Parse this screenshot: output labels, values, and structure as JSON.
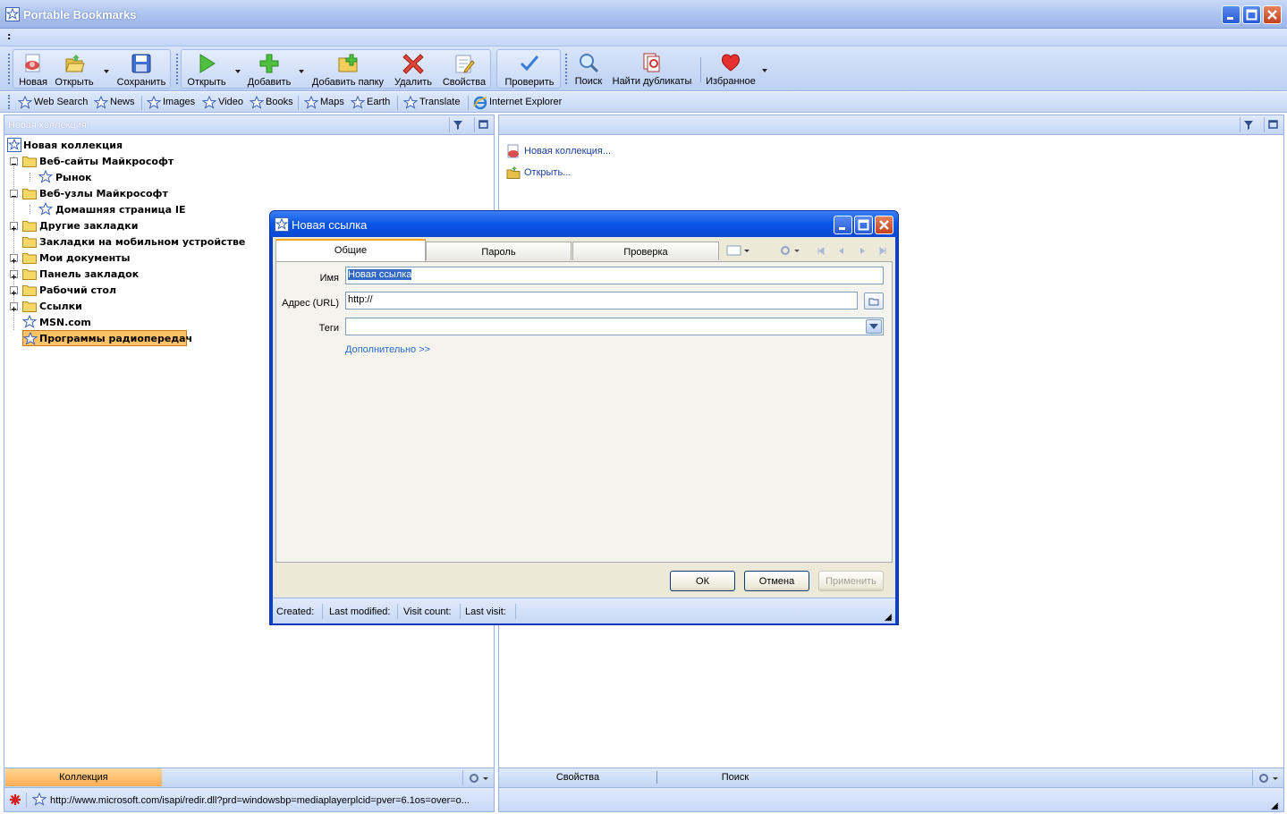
{
  "window": {
    "title": "Portable Bookmarks"
  },
  "menubar": {
    "overflow": ":"
  },
  "toolbar": {
    "new": "Новая",
    "open": "Открыть",
    "save": "Сохранить",
    "open2": "Открыть",
    "add": "Добавить",
    "add_folder": "Добавить папку",
    "delete": "Удалить",
    "properties": "Свойства",
    "check": "Проверить",
    "search": "Поиск",
    "find_duplicates": "Найти дубликаты",
    "favorites": "Избранное"
  },
  "links": [
    {
      "label": "Web Search"
    },
    {
      "label": "News"
    },
    {
      "label": "Images"
    },
    {
      "label": "Video"
    },
    {
      "label": "Books"
    },
    {
      "label": "Maps"
    },
    {
      "label": "Earth"
    },
    {
      "label": "Translate"
    },
    {
      "label": "Internet Explorer"
    }
  ],
  "left_panel": {
    "header": "Новая коллекция",
    "tree": [
      {
        "label": "Новая коллекция"
      },
      {
        "label": "Веб-сайты Майкрософт"
      },
      {
        "label": "Рынок"
      },
      {
        "label": "Веб-узлы Майкрософт"
      },
      {
        "label": "Домашняя страница IE"
      },
      {
        "label": "Другие закладки"
      },
      {
        "label": "Закладки на мобильном устройстве"
      },
      {
        "label": "Мои документы"
      },
      {
        "label": "Панель закладок"
      },
      {
        "label": "Рабочий стол"
      },
      {
        "label": "Ссылки"
      },
      {
        "label": "MSN.com"
      },
      {
        "label": "Программы радиопередач"
      }
    ],
    "tab_collection": "Коллекция",
    "status_url": "http://www.microsoft.com/isapi/redir.dll?prd=windowsbp=mediaplayerplcid=pver=6.1os=over=o..."
  },
  "right_panel": {
    "actions": [
      {
        "label": "Новая коллекция..."
      },
      {
        "label": "Открыть..."
      }
    ],
    "tab_properties": "Свойства",
    "tab_search": "Поиск"
  },
  "dialog": {
    "title": "Новая ссылка",
    "tabs": {
      "general": "Общие",
      "password": "Пароль",
      "check": "Проверка"
    },
    "name_label": "Имя",
    "name_value": "Новая ссылка",
    "url_label": "Адрес (URL)",
    "url_value": "http://",
    "tags_label": "Теги",
    "tags_value": "",
    "more_link": "Дополнительно >>",
    "ok": "ОК",
    "cancel": "Отмена",
    "apply": "Применить",
    "status": {
      "created": "Created:",
      "modified": "Last modified:",
      "visits": "Visit count:",
      "last_visit": "Last visit:"
    }
  },
  "colors": {
    "accent": "#0a55e6",
    "selection": "#ffc266",
    "link": "#1a4fb8"
  }
}
